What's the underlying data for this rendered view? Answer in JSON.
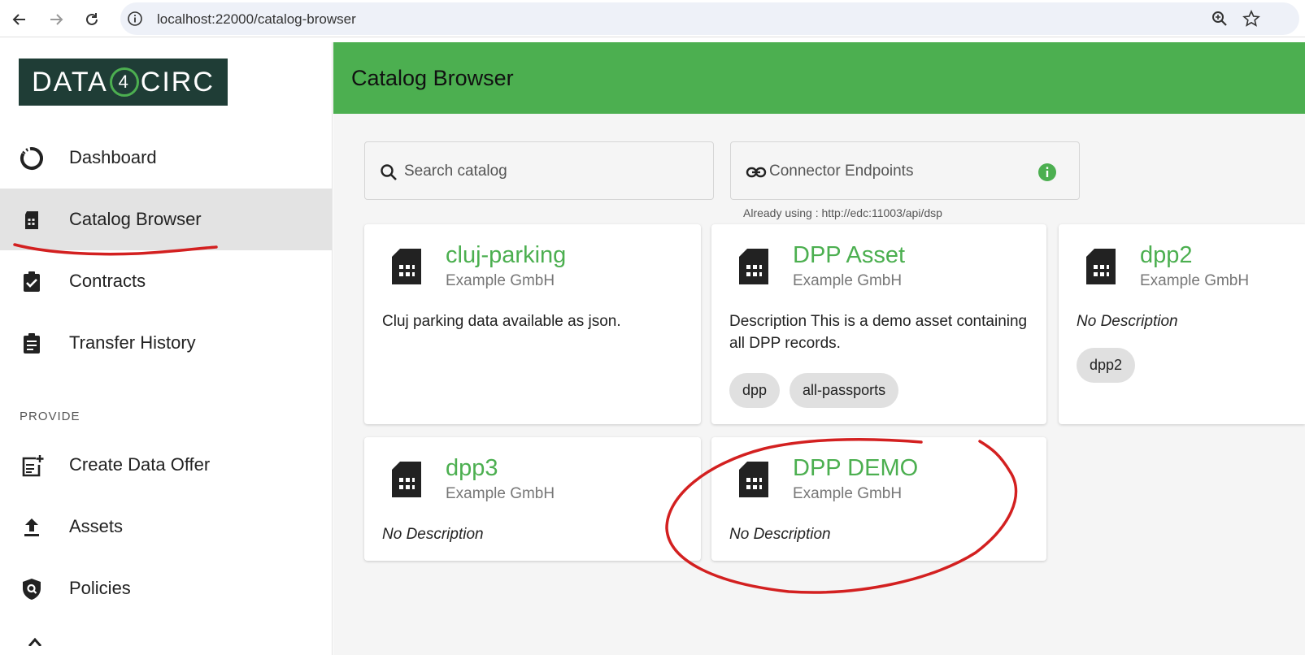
{
  "browser": {
    "url": "localhost:22000/catalog-browser"
  },
  "sidebar": {
    "logo_text_left": "DATA",
    "logo_text_mid": "4",
    "logo_text_right": "CIRC",
    "items": [
      {
        "label": "Dashboard",
        "icon": "dashboard-icon"
      },
      {
        "label": "Catalog Browser",
        "icon": "catalog-icon"
      },
      {
        "label": "Contracts",
        "icon": "contracts-icon"
      },
      {
        "label": "Transfer History",
        "icon": "transfer-history-icon"
      }
    ],
    "section_provide": "PROVIDE",
    "provide_items": [
      {
        "label": "Create Data Offer",
        "icon": "create-offer-icon"
      },
      {
        "label": "Assets",
        "icon": "upload-icon"
      },
      {
        "label": "Policies",
        "icon": "policy-shield-icon"
      }
    ]
  },
  "header": {
    "title": "Catalog Browser"
  },
  "search": {
    "placeholder": "Search catalog"
  },
  "connector": {
    "placeholder": "Connector Endpoints",
    "hint": "Already using : http://edc:11003/api/dsp"
  },
  "cards": [
    {
      "title": "cluj-parking",
      "provider": "Example GmbH",
      "description": "Cluj parking data available as json.",
      "tags": []
    },
    {
      "title": "DPP Asset",
      "provider": "Example GmbH",
      "description": "Description This is a demo asset containing all DPP records.",
      "tags": [
        "dpp",
        "all-passports"
      ]
    },
    {
      "title": "dpp2",
      "provider": "Example GmbH",
      "description": "No Description",
      "tags": [
        "dpp2"
      ]
    },
    {
      "title": "dpp3",
      "provider": "Example GmbH",
      "description": "No Description",
      "tags": []
    },
    {
      "title": "DPP DEMO",
      "provider": "Example GmbH",
      "description": "No Description",
      "tags": []
    }
  ],
  "colors": {
    "accent": "#4caf50",
    "logo_bg": "#1f3d36",
    "annotation": "#d32020"
  }
}
